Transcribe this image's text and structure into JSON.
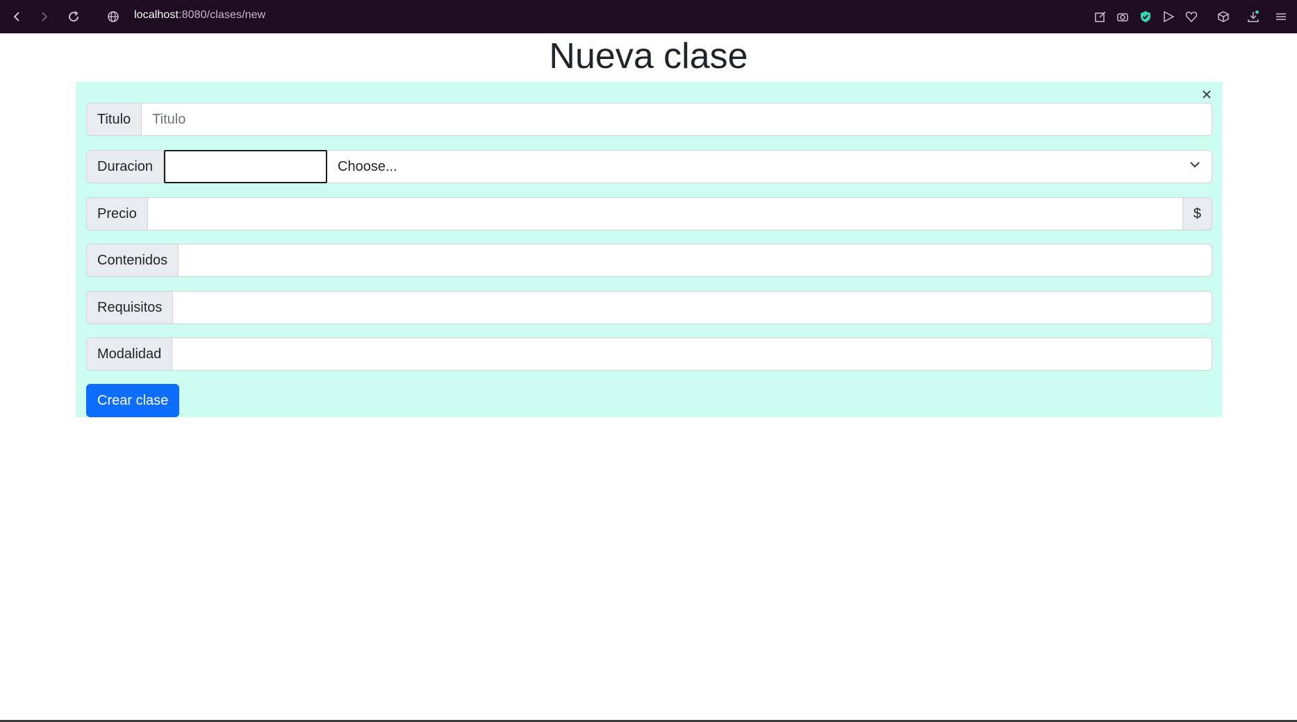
{
  "browser": {
    "url_host": "localhost",
    "url_rest": ":8080/clases/new"
  },
  "page": {
    "title": "Nueva clase"
  },
  "form": {
    "titulo": {
      "label": "Titulo",
      "placeholder": "Titulo",
      "value": ""
    },
    "duracion": {
      "label": "Duracion",
      "value": "",
      "unit_selected": "Choose..."
    },
    "precio": {
      "label": "Precio",
      "value": "",
      "suffix": "$"
    },
    "contenidos": {
      "label": "Contenidos",
      "value": ""
    },
    "requisitos": {
      "label": "Requisitos",
      "value": ""
    },
    "modalidad": {
      "label": "Modalidad",
      "value": ""
    },
    "submit_label": "Crear clase"
  },
  "colors": {
    "chrome_bg": "#1e0c21",
    "panel_bg": "#ccfdf0",
    "primary": "#0d6efd"
  }
}
